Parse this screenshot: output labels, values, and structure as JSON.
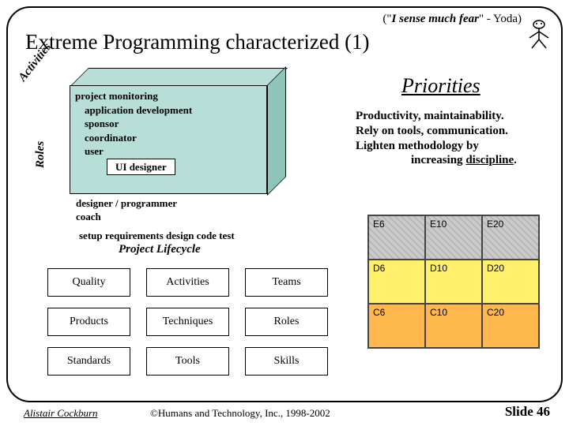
{
  "quote_prefix": "(\"",
  "quote_text": "I sense much fear",
  "quote_suffix": "\" - Yoda)",
  "title": "Extreme Programming characterized (1)",
  "activities_label": "Activities",
  "roles_label": "Roles",
  "box": {
    "l1": "project monitoring",
    "l2": "application development",
    "l3": "sponsor",
    "l4": "coordinator",
    "l5": "user",
    "l6": "UI designer"
  },
  "below": {
    "l1": "designer / programmer",
    "l2": "coach"
  },
  "lifecycle_items": "setup   requirements  design  code  test",
  "lifecycle_title": "Project Lifecycle",
  "grid9": {
    "r0c0": "Quality",
    "r0c1": "Activities",
    "r0c2": "Teams",
    "r1c0": "Products",
    "r1c1": "Techniques",
    "r1c2": "Roles",
    "r2c0": "Standards",
    "r2c1": "Tools",
    "r2c2": "Skills"
  },
  "priorities_title": "Priorities",
  "priorities_body": {
    "l1": "Productivity, maintainability.",
    "l2": "Rely on tools, communication.",
    "l3a": "Lighten methodology by",
    "l3b_prefix": "increasing ",
    "l3b_word": "discipline",
    "l3b_suffix": "."
  },
  "prio_cells": {
    "e6": "E6",
    "e10": "E10",
    "e20": "E20",
    "d6": "D6",
    "d10": "D10",
    "d20": "D20",
    "c6": "C6",
    "c10": "C10",
    "c20": "C20"
  },
  "footer_author": "Alistair Cockburn",
  "footer_copyright": "©Humans and Technology, Inc., 1998-2002",
  "footer_slide": "Slide 46"
}
